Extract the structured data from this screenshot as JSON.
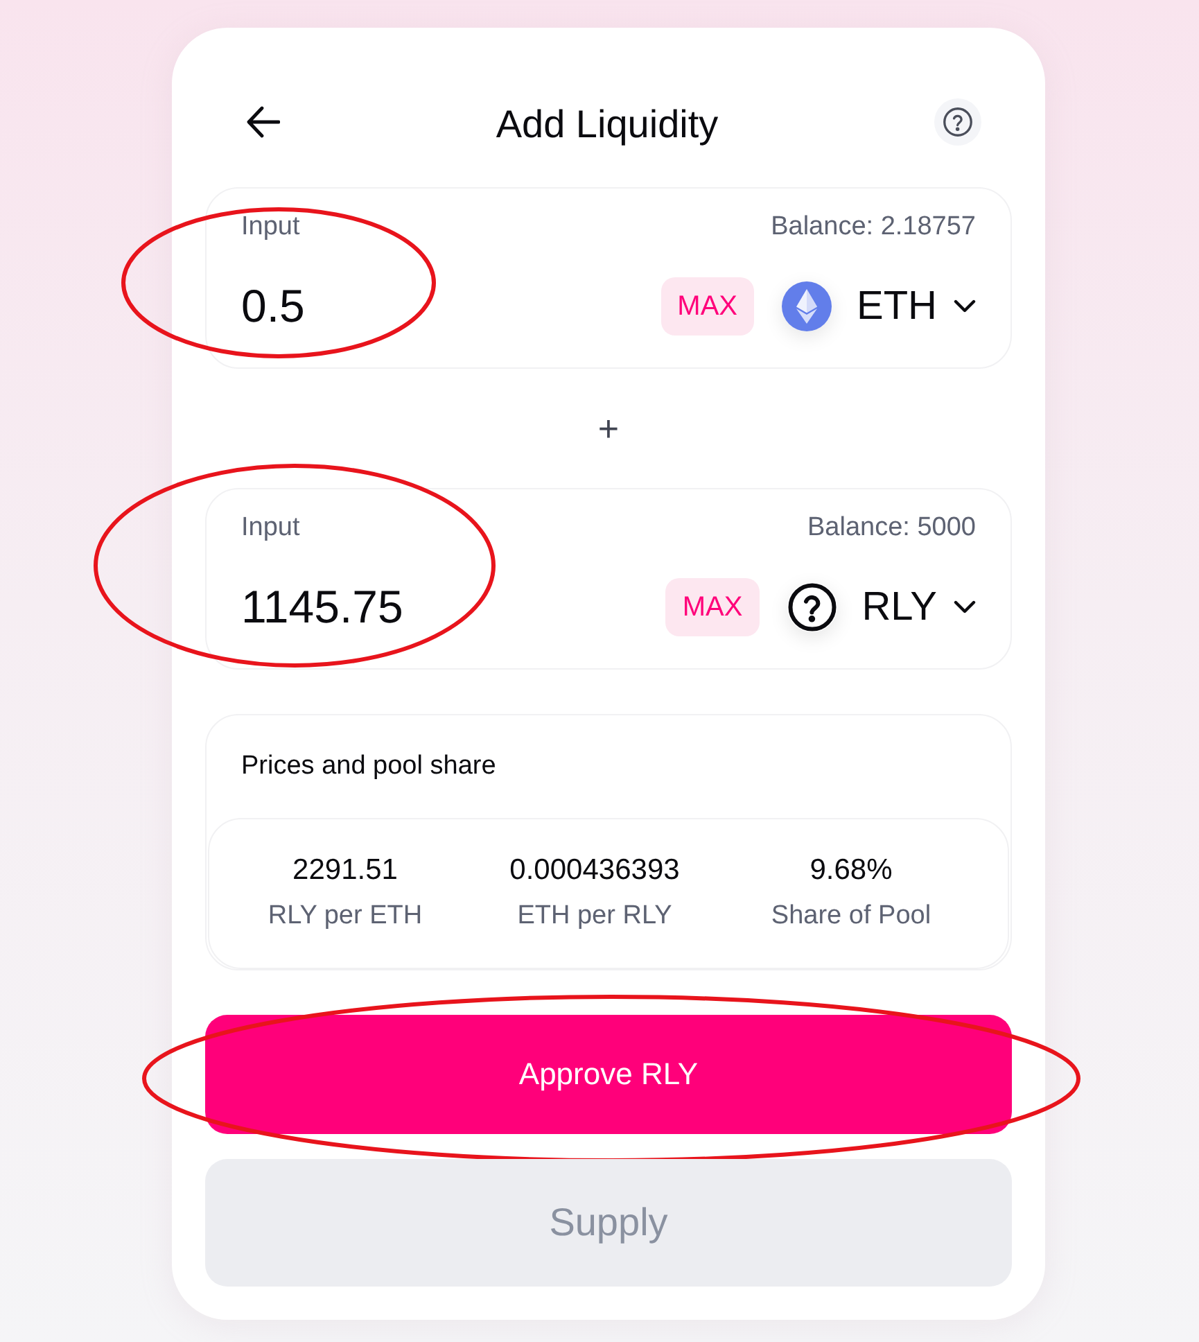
{
  "header": {
    "title": "Add Liquidity"
  },
  "inputs": [
    {
      "label": "Input",
      "balance": "Balance: 2.18757",
      "value": "0.5",
      "max_label": "MAX",
      "token": {
        "symbol": "ETH",
        "kind": "eth"
      },
      "circled": true
    },
    {
      "label": "Input",
      "balance": "Balance: 5000",
      "value": "1145.75",
      "max_label": "MAX",
      "token": {
        "symbol": "RLY",
        "kind": "unknown"
      },
      "circled": true
    }
  ],
  "separator": "+",
  "prices": {
    "title": "Prices and pool share",
    "stats": [
      {
        "value": "2291.51",
        "label": "RLY per ETH"
      },
      {
        "value": "0.000436393",
        "label": "ETH per RLY"
      },
      {
        "value": "9.68%",
        "label": "Share of Pool"
      }
    ]
  },
  "buttons": [
    {
      "label": "Approve RLY",
      "disabled": false,
      "circled": true
    },
    {
      "label": "Supply",
      "disabled": true,
      "circled": false
    }
  ]
}
